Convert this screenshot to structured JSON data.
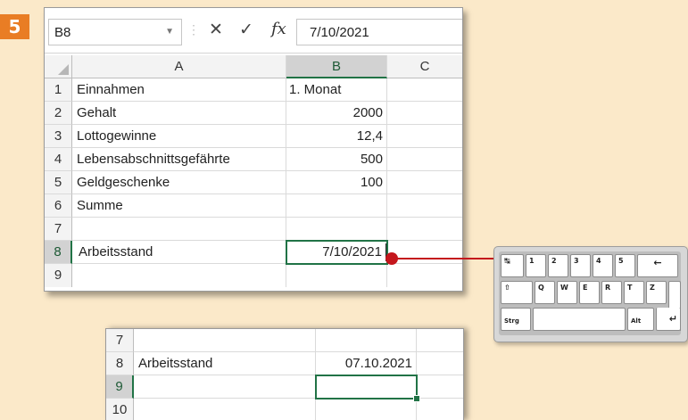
{
  "step": {
    "number": "5"
  },
  "formula_bar": {
    "name_box": "B8",
    "formula": "7/10/2021",
    "icons": [
      "dropdown-icon",
      "cancel-icon",
      "enter-check-icon",
      "fx-icon"
    ]
  },
  "sheet_top": {
    "columns": [
      "A",
      "B",
      "C"
    ],
    "rows": [
      {
        "num": "1",
        "a": "Einnahmen",
        "b": "1. Monat"
      },
      {
        "num": "2",
        "a": "Gehalt",
        "b": "2000"
      },
      {
        "num": "3",
        "a": "Lottogewinne",
        "b": "12,4"
      },
      {
        "num": "4",
        "a": "Lebensabschnittsgefährte",
        "b": "500"
      },
      {
        "num": "5",
        "a": "Geldgeschenke",
        "b": "100"
      },
      {
        "num": "6",
        "a": "Summe",
        "b": ""
      },
      {
        "num": "7",
        "a": "",
        "b": ""
      },
      {
        "num": "8",
        "a": "Arbeitsstand",
        "b": "7/10/2021"
      },
      {
        "num": "9",
        "a": "",
        "b": ""
      }
    ],
    "active_cell": "B8"
  },
  "keyboard": {
    "keys": {
      "tab": "↹",
      "k1": "1",
      "k2": "2",
      "k3": "3",
      "k4": "4",
      "k5": "5",
      "backspace": "←",
      "shift": "⇧",
      "q": "Q",
      "w": "W",
      "e": "E",
      "r": "R",
      "t": "T",
      "z": "Z",
      "strg": "Strg",
      "alt": "Alt",
      "enter": "↵"
    },
    "highlighted_key": "enter"
  },
  "sheet_bottom": {
    "rows": [
      {
        "num": "7",
        "a": "",
        "b": ""
      },
      {
        "num": "8",
        "a": "Arbeitsstand",
        "b": "07.10.2021"
      },
      {
        "num": "9",
        "a": "",
        "b": ""
      },
      {
        "num": "10",
        "a": "",
        "b": ""
      }
    ],
    "active_cell": "B9"
  },
  "colors": {
    "background": "#fbe9c9",
    "badge": "#e97d24",
    "selection": "#217346",
    "callout": "#c4161c"
  }
}
